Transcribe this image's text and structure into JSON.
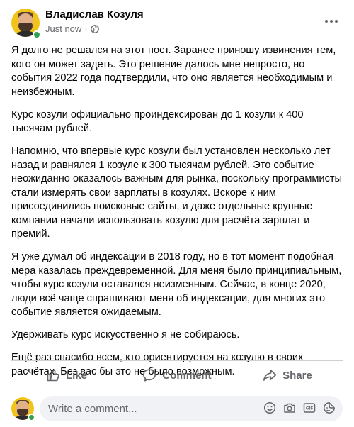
{
  "post": {
    "author": "Владислав Козуля",
    "time": "Just now",
    "separator": "·",
    "paragraphs": [
      "Я долго не решался на этот пост. Заранее приношу извинения тем, кого он может задеть. Это решение далось мне непросто, но события 2022 года подтвердили, что оно является необходимым и неизбежным.",
      "Курс козули официально проиндексирован до 1 козули к 400 тысячам рублей.",
      "Напомню, что впервые курс козули был установлен несколько лет назад и равнялся 1 козуле к 300 тысячам рублей. Это событие неожиданно оказалось важным для рынка, поскольку программисты стали измерять свои зарплаты в козулях. Вскоре к ним присоединились поисковые сайты, и даже отдельные крупные компании начали использовать козулю для расчёта зарплат и премий.",
      "Я уже думал об индексации в 2018 году, но в тот момент подобная мера казалась преждевременной. Для меня было принципиальным, чтобы курс козули оставался неизменным. Сейчас, в конце 2020, люди всё чаще спрашивают меня об индексации, для многих это событие является ожидаемым.",
      "Удерживать курс искусственно я не собираюсь.",
      "Ещё раз спасибо всем, кто ориентируется на козулю в своих расчётах. Без вас бы это не было возможным."
    ]
  },
  "actions": {
    "like_label": "Like",
    "comment_label": "Comment",
    "share_label": "Share"
  },
  "comment_box": {
    "placeholder": "Write a comment..."
  },
  "icons": {
    "privacy": "globe-icon",
    "more": "more-icon",
    "like": "thumbs-up-icon",
    "comment": "comment-bubble-icon",
    "share": "share-arrow-icon",
    "emoji": "emoji-icon",
    "camera": "camera-icon",
    "gif": "gif-icon",
    "sticker": "sticker-icon"
  },
  "colors": {
    "text": "#050505",
    "secondary": "#65676b",
    "online": "#31a24c",
    "input_bg": "#f0f2f5",
    "divider": "#ced0d4"
  }
}
